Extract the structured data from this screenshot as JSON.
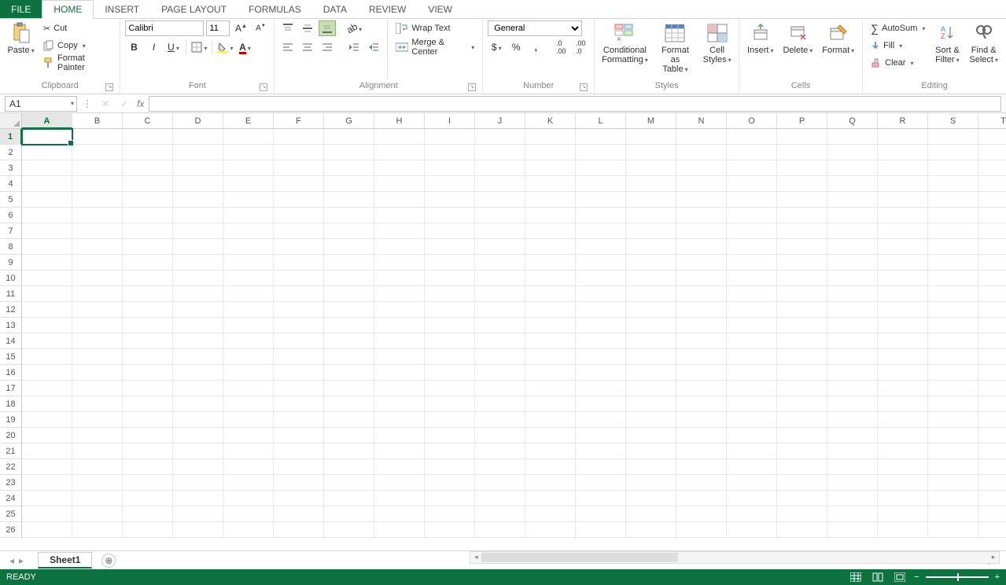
{
  "tabs": {
    "file": "FILE",
    "home": "HOME",
    "insert": "INSERT",
    "page_layout": "PAGE LAYOUT",
    "formulas": "FORMULAS",
    "data": "DATA",
    "review": "REVIEW",
    "view": "VIEW",
    "active": "HOME"
  },
  "ribbon": {
    "clipboard": {
      "label": "Clipboard",
      "paste": "Paste",
      "cut": "Cut",
      "copy": "Copy",
      "format_painter": "Format Painter"
    },
    "font": {
      "label": "Font",
      "font_name": "Calibri",
      "font_size": "11"
    },
    "alignment": {
      "label": "Alignment",
      "wrap_text": "Wrap Text",
      "merge_center": "Merge & Center"
    },
    "number": {
      "label": "Number",
      "format": "General"
    },
    "styles": {
      "label": "Styles",
      "conditional": "Conditional\nFormatting",
      "format_as_table": "Format as\nTable",
      "cell_styles": "Cell\nStyles"
    },
    "cells": {
      "label": "Cells",
      "insert": "Insert",
      "delete": "Delete",
      "format": "Format"
    },
    "editing": {
      "label": "Editing",
      "autosum": "AutoSum",
      "fill": "Fill",
      "clear": "Clear",
      "sort_filter": "Sort &\nFilter",
      "find_select": "Find &\nSelect"
    }
  },
  "name_box": "A1",
  "formula_bar": "",
  "grid": {
    "columns": [
      "A",
      "B",
      "C",
      "D",
      "E",
      "F",
      "G",
      "H",
      "I",
      "J",
      "K",
      "L",
      "M",
      "N",
      "O",
      "P",
      "Q",
      "R",
      "S",
      "T"
    ],
    "rows": [
      1,
      2,
      3,
      4,
      5,
      6,
      7,
      8,
      9,
      10,
      11,
      12,
      13,
      14,
      15,
      16,
      17,
      18,
      19,
      20,
      21,
      22,
      23,
      24,
      25,
      26
    ],
    "selected_col": "A",
    "selected_row": 1,
    "active_cell": "A1"
  },
  "sheet_tabs": {
    "active": "Sheet1"
  },
  "status": {
    "ready": "READY",
    "zoom": "100%"
  },
  "colors": {
    "accent": "#0e7140",
    "font_color": "#c00000",
    "fill_color": "#ffff00"
  }
}
